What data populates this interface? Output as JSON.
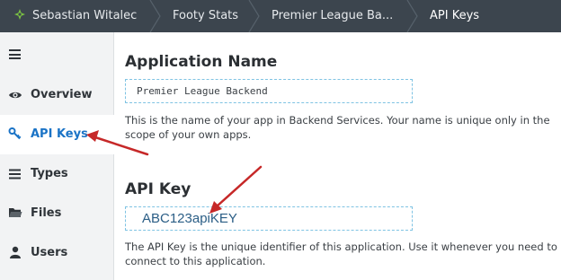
{
  "breadcrumb": {
    "user": "Sebastian Witalec",
    "app": "Footy Stats",
    "project": "Premier League Ba...",
    "page": "API Keys"
  },
  "colors": {
    "topbar": "#3c454e",
    "sidebar": "#f2f3f4",
    "active_nav": "#1a73c6",
    "field_border": "#7fc3e3",
    "annotation_arrow": "#c62828",
    "logo": "#7ac143"
  },
  "sidebar": {
    "menu_icon": "hamburger-icon",
    "items": [
      {
        "label": "Overview",
        "icon": "eye-icon",
        "active": false
      },
      {
        "label": "API Keys",
        "icon": "key-icon",
        "active": true
      },
      {
        "label": "Types",
        "icon": "list-icon",
        "active": false
      },
      {
        "label": "Files",
        "icon": "folder-icon",
        "active": false
      },
      {
        "label": "Users",
        "icon": "user-icon",
        "active": false
      }
    ]
  },
  "main": {
    "app_name": {
      "title": "Application Name",
      "value": "Premier League Backend",
      "help": "This is the name of your app in Backend Services. Your name is unique only in the scope of your own apps."
    },
    "api_key": {
      "title": "API Key",
      "value": "ABC123apiKEY",
      "help": "The API Key is the unique identifier of this application. Use it whenever you need to connect to this application."
    }
  }
}
